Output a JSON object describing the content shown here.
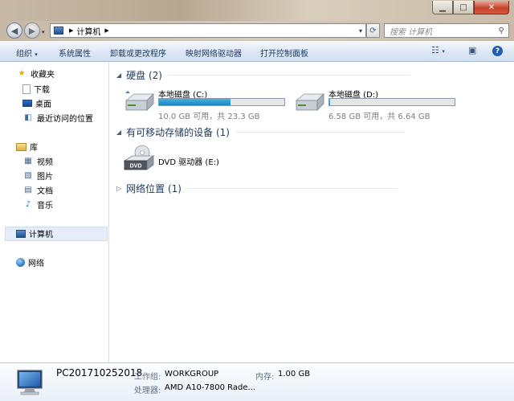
{
  "address_bar": {
    "path": [
      "计算机"
    ],
    "search_placeholder": "搜索 计算机"
  },
  "toolbar": {
    "organize": "组织",
    "system_properties": "系统属性",
    "uninstall": "卸载或更改程序",
    "map_drive": "映射网络驱动器",
    "control_panel": "打开控制面板"
  },
  "sidebar": {
    "favorites": "收藏夹",
    "downloads": "下载",
    "desktop": "桌面",
    "recent": "最近访问的位置",
    "libraries": "库",
    "videos": "视频",
    "pictures": "图片",
    "documents": "文档",
    "music": "音乐",
    "computer": "计算机",
    "network": "网络"
  },
  "groups": {
    "hdd": "硬盘 (2)",
    "removable": "有可移动存储的设备 (1)",
    "network": "网络位置 (1)"
  },
  "drives": [
    {
      "name": "本地磁盘 (C:)",
      "info": "10.0 GB 可用，共 23.3 GB",
      "used_fraction": 0.571
    },
    {
      "name": "本地磁盘 (D:)",
      "info": "6.58 GB 可用，共 6.64 GB",
      "used_fraction": 0.009
    }
  ],
  "dvd": {
    "name": "DVD 驱动器 (E:)",
    "badge": "DVD"
  },
  "details": {
    "pc_name": "PC201710252018",
    "workgroup_label": "工作组:",
    "workgroup_value": "WORKGROUP",
    "memory_label": "内存:",
    "memory_value": "1.00 GB",
    "cpu_label": "处理器:",
    "cpu_value": "AMD A10-7800 Rade..."
  },
  "colors": {
    "accent": "#1e395b",
    "progress": "#26a0da",
    "selection": "#e5eef8"
  }
}
